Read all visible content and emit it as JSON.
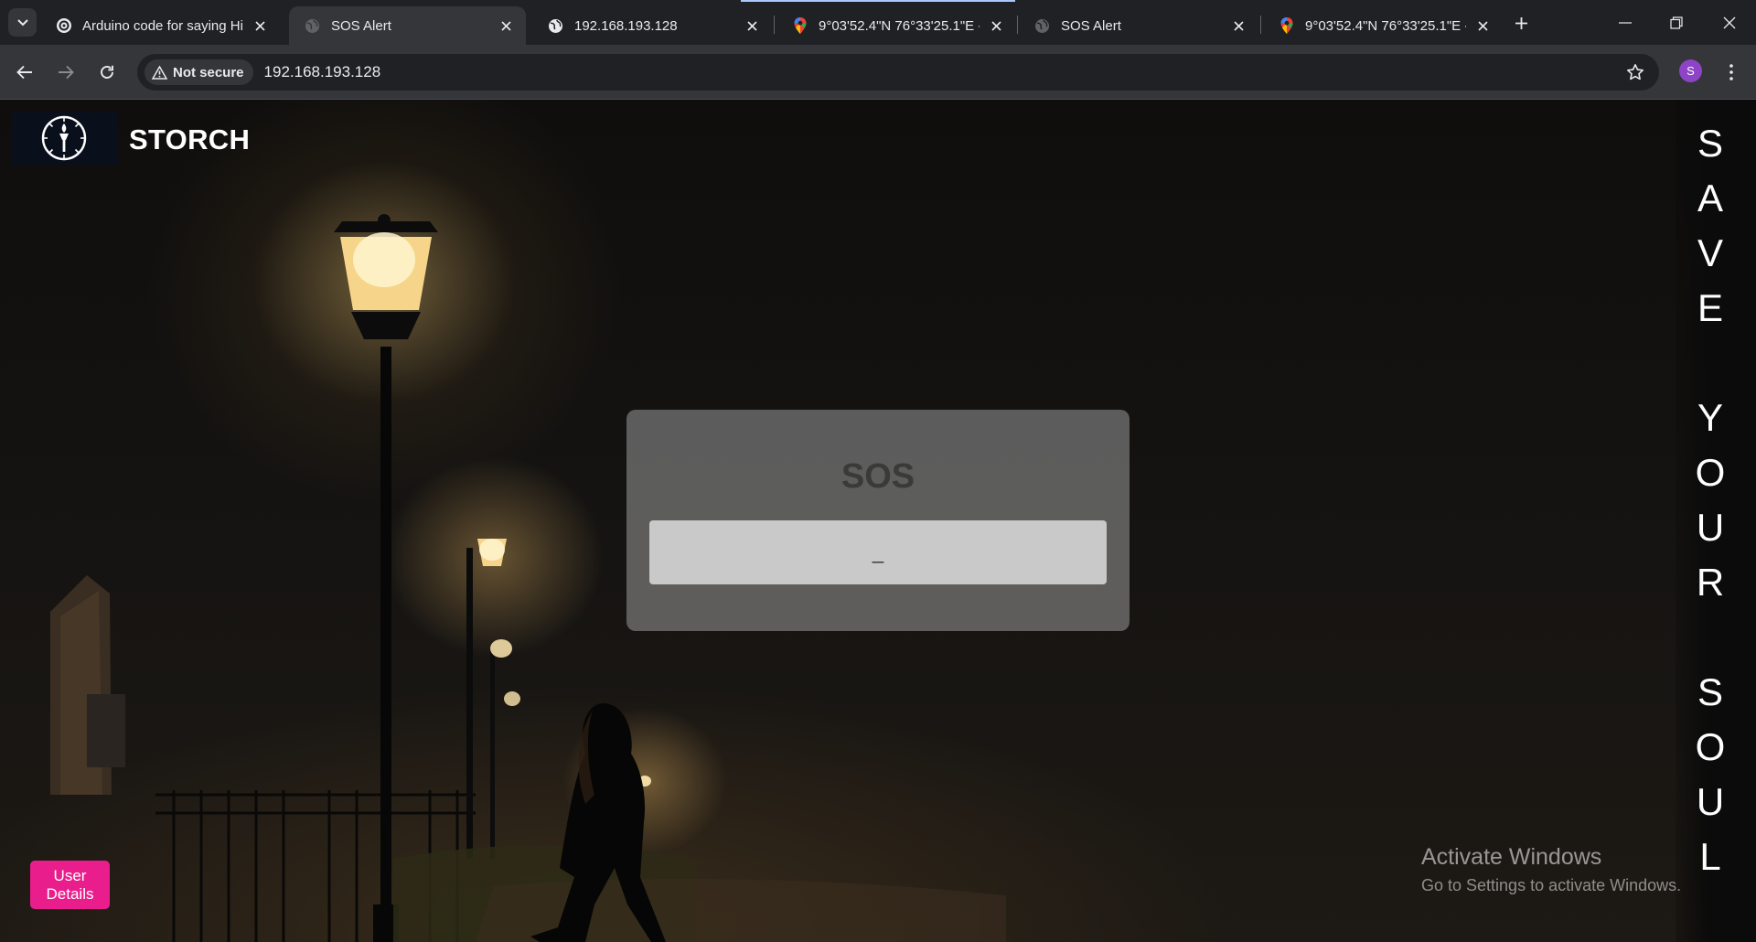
{
  "browser": {
    "tabs": [
      {
        "title": "Arduino code for saying Hi",
        "icon": "chatgpt-icon",
        "active": false
      },
      {
        "title": "SOS Alert",
        "icon": "globe-icon",
        "active": true
      },
      {
        "title": "192.168.193.128",
        "icon": "globe-icon",
        "active": false
      },
      {
        "title": "9°03'52.4\"N 76°33'25.1\"E -",
        "icon": "maps-pin-icon",
        "active": false
      },
      {
        "title": "SOS Alert",
        "icon": "globe-icon",
        "active": false
      },
      {
        "title": "9°03'52.4\"N 76°33'25.1\"E -",
        "icon": "maps-pin-icon",
        "active": false
      }
    ],
    "security_chip": "Not secure",
    "url": "192.168.193.128",
    "profile_initial": "S"
  },
  "page": {
    "brand": "STORCH",
    "sidebar_letters": [
      "S",
      "A",
      "V",
      "E",
      "",
      "Y",
      "O",
      "U",
      "R",
      "",
      "S",
      "O",
      "U",
      "L"
    ],
    "sos_card": {
      "title": "SOS",
      "field_value": "_"
    },
    "user_button": "User Details",
    "watermark": {
      "title": "Activate Windows",
      "subtitle": "Go to Settings to activate Windows."
    }
  },
  "colors": {
    "accent_button": "#e91e8c",
    "browser_frame": "#202124",
    "toolbar": "#35363a"
  }
}
